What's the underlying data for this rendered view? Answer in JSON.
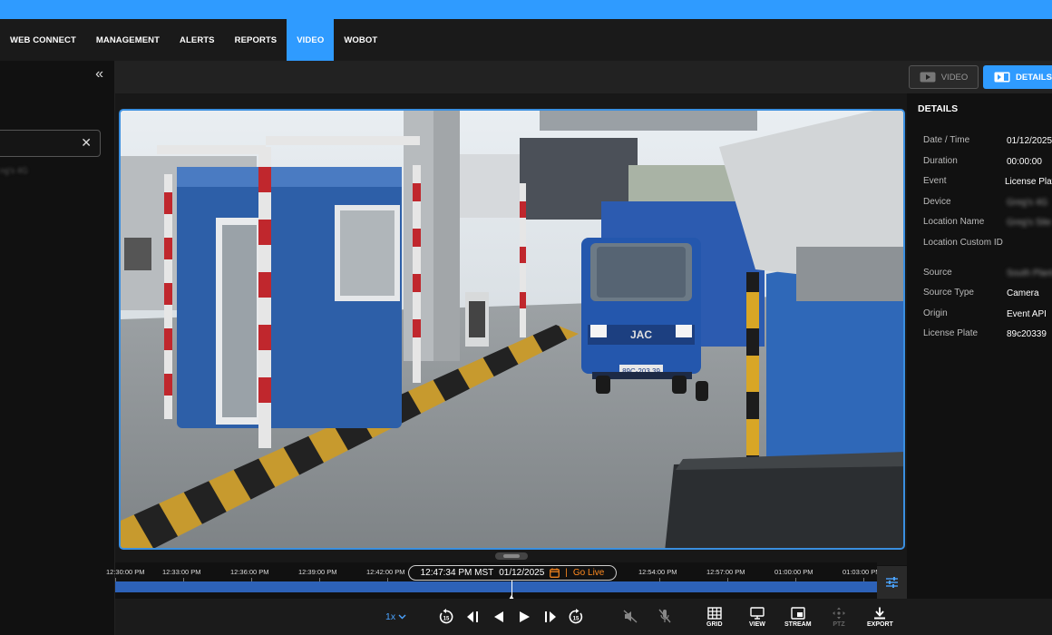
{
  "nav": {
    "items": [
      {
        "label": "WEB CONNECT",
        "active": false
      },
      {
        "label": "MANAGEMENT",
        "active": false
      },
      {
        "label": "ALERTS",
        "active": false
      },
      {
        "label": "REPORTS",
        "active": false
      },
      {
        "label": "VIDEO",
        "active": true
      },
      {
        "label": "WOBOT",
        "active": false
      }
    ]
  },
  "sidebar": {
    "collapse_icon": "double-chevron-left-icon",
    "search_value": "",
    "item_label": "ng's 4G"
  },
  "view_toggle": {
    "video_label": "VIDEO",
    "details_label": "DETAILS"
  },
  "details": {
    "title": "DETAILS",
    "rows": [
      {
        "label": "Date / Time",
        "value": "01/12/2025"
      },
      {
        "label": "Duration",
        "value": "00:00:00"
      },
      {
        "label": "Event",
        "value": "License Plate"
      },
      {
        "label": "Device",
        "value": "Greg's 4G",
        "blurred": true
      },
      {
        "label": "Location Name",
        "value": "Greg's Site",
        "blurred": true
      },
      {
        "label": "Location Custom ID",
        "value": ""
      },
      {
        "label": "Source",
        "value": "South Plant",
        "blurred": true
      },
      {
        "label": "Source Type",
        "value": "Camera"
      },
      {
        "label": "Origin",
        "value": "Event API"
      },
      {
        "label": "License Plate",
        "value": "89c20339"
      }
    ]
  },
  "timeline": {
    "ticks": [
      "12:30:00 PM",
      "12:33:00 PM",
      "12:36:00 PM",
      "12:39:00 PM",
      "12:42:00 PM",
      "12:54:00 PM",
      "12:57:00 PM",
      "01:00:00 PM",
      "01:03:00 PM"
    ],
    "current_time": "12:47:34 PM MST",
    "current_date": "01/12/2025",
    "go_live": "Go Live"
  },
  "controls": {
    "speed": "1x",
    "grid": "GRID",
    "view": "VIEW",
    "stream": "STREAM",
    "ptz": "PTZ",
    "export": "EXPORT"
  },
  "scene": {
    "truck_brand": "JAC",
    "truck_plate": "89C-203.39"
  },
  "colors": {
    "accent": "#2f9bff",
    "timeline_bar": "#2d62b8",
    "go_live": "#ff8a1f",
    "panel_bg": "#111111"
  }
}
